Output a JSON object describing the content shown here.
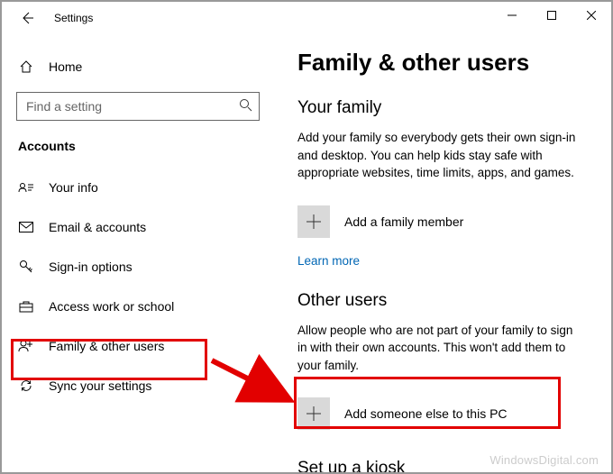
{
  "titlebar": {
    "title": "Settings"
  },
  "sidebar": {
    "home_label": "Home",
    "search_placeholder": "Find a setting",
    "section_label": "Accounts",
    "items": [
      {
        "label": "Your info"
      },
      {
        "label": "Email & accounts"
      },
      {
        "label": "Sign-in options"
      },
      {
        "label": "Access work or school"
      },
      {
        "label": "Family & other users"
      },
      {
        "label": "Sync your settings"
      }
    ]
  },
  "main": {
    "page_title": "Family & other users",
    "family": {
      "heading": "Your family",
      "description": "Add your family so everybody gets their own sign-in and desktop. You can help kids stay safe with appropriate websites, time limits, apps, and games.",
      "add_label": "Add a family member",
      "learn_more": "Learn more"
    },
    "other": {
      "heading": "Other users",
      "description": "Allow people who are not part of your family to sign in with their own accounts. This won't add them to your family.",
      "add_label": "Add someone else to this PC"
    },
    "kiosk": {
      "heading": "Set up a kiosk"
    }
  },
  "watermark": "WindowsDigital.com"
}
